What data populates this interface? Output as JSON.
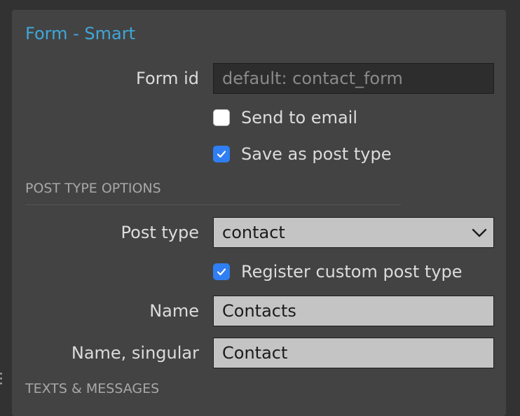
{
  "panel": {
    "title": "Form - Smart"
  },
  "form_id": {
    "label": "Form id",
    "value": "",
    "placeholder": "default: contact_form"
  },
  "send_to_email": {
    "label": "Send to email",
    "checked": false
  },
  "save_as_post_type": {
    "label": "Save as post type",
    "checked": true
  },
  "post_type_options": {
    "header": "POST TYPE OPTIONS"
  },
  "post_type": {
    "label": "Post type",
    "selected": "contact"
  },
  "register_custom_post_type": {
    "label": "Register custom post type",
    "checked": true
  },
  "name": {
    "label": "Name",
    "value": "Contacts"
  },
  "name_singular": {
    "label": "Name, singular",
    "value": "Contact"
  },
  "texts_messages": {
    "header": "TEXTS & MESSAGES"
  },
  "colors": {
    "title_accent": "#3fa7d9",
    "checkbox_checked": "#2f7ef3",
    "panel_bg": "#434343",
    "page_bg": "#323232"
  }
}
